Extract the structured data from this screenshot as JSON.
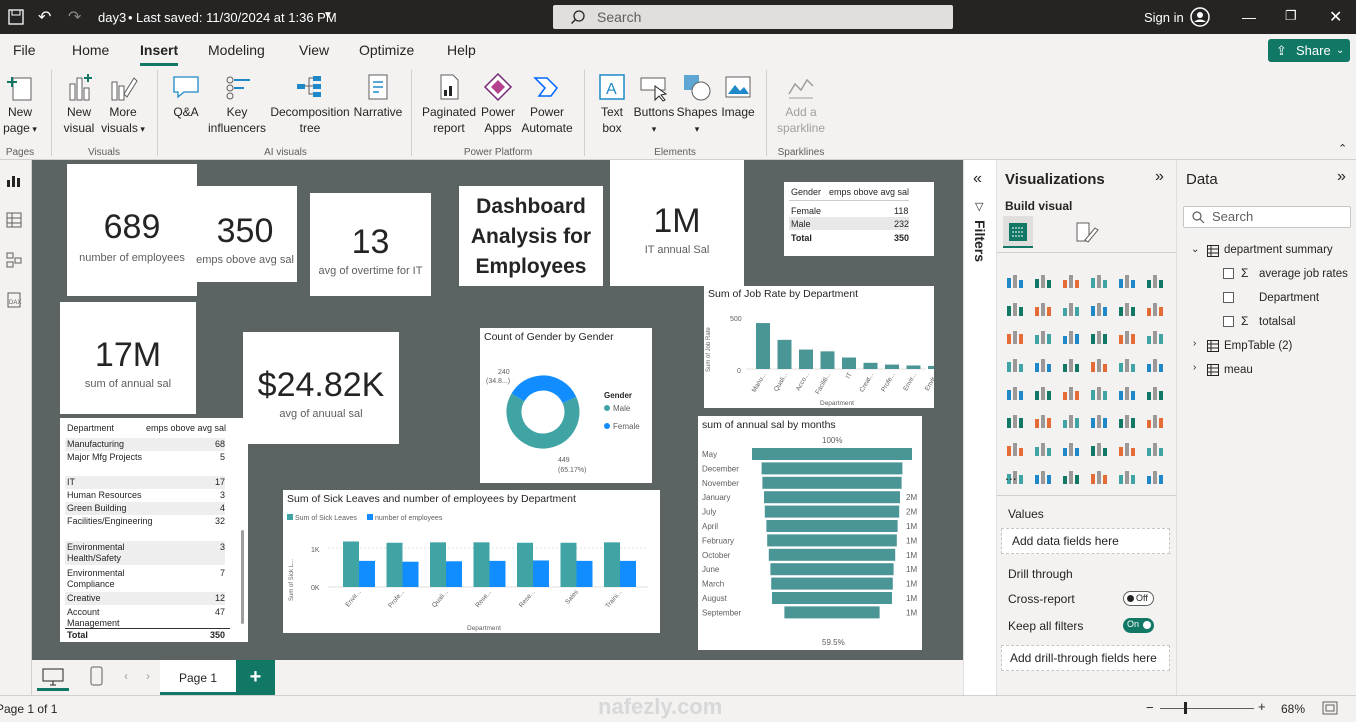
{
  "titlebar": {
    "file_title": "day3",
    "saved": "Last saved: 11/30/2024 at 1:36 PM",
    "search_placeholder": "Search",
    "signin": "Sign in"
  },
  "menu": {
    "file": "File",
    "home": "Home",
    "insert": "Insert",
    "modeling": "Modeling",
    "view": "View",
    "optimize": "Optimize",
    "help": "Help",
    "share": "Share"
  },
  "ribbon": {
    "new_page": [
      "New",
      "page"
    ],
    "new_visual": [
      "New",
      "visual"
    ],
    "more_visuals": [
      "More",
      "visuals"
    ],
    "qa": "Q&A",
    "key_influencers": [
      "Key",
      "influencers"
    ],
    "decomp": [
      "Decomposition",
      "tree"
    ],
    "narrative": "Narrative",
    "paginated": [
      "Paginated",
      "report"
    ],
    "power_apps": [
      "Power",
      "Apps"
    ],
    "power_automate": [
      "Power",
      "Automate"
    ],
    "text_box": [
      "Text",
      "box"
    ],
    "buttons": "Buttons",
    "shapes": "Shapes",
    "image": "Image",
    "sparkline": [
      "Add a",
      "sparkline"
    ],
    "groups": {
      "pages": "Pages",
      "visuals": "Visuals",
      "ai": "AI visuals",
      "platform": "Power Platform",
      "elements": "Elements",
      "sparklines": "Sparklines"
    }
  },
  "cards": {
    "employees": {
      "value": "689",
      "label": "number of employees"
    },
    "above": {
      "value": "350",
      "label": "emps obove avg sal"
    },
    "overtime": {
      "value": "13",
      "label": "avg of overtime for IT"
    },
    "title": "Dashboard Analysis for Employees",
    "it_sal": {
      "value": "1M",
      "label": "IT annual Sal"
    },
    "annual": {
      "value": "17M",
      "label": "sum of annual sal"
    },
    "avg_sal": {
      "value": "$24.82K",
      "label": "avg of anuual sal"
    }
  },
  "gender_table": {
    "headers": [
      "Gender",
      "emps obove avg sal"
    ],
    "rows": [
      [
        "Female",
        "118"
      ],
      [
        "Male",
        "232"
      ]
    ],
    "total": [
      "Total",
      "350"
    ]
  },
  "dept_table": {
    "headers": [
      "Department",
      "emps obove avg sal"
    ],
    "rows": [
      [
        "Manufacturing",
        "68"
      ],
      [
        "Major Mfg Projects",
        "5"
      ],
      [
        "IT",
        "17"
      ],
      [
        "Human Resources",
        "3"
      ],
      [
        "Green Building",
        "4"
      ],
      [
        "Facilities/Engineering",
        "32"
      ],
      [
        "Environmental Health/Safety",
        "3"
      ],
      [
        "Environmental Compliance",
        "7"
      ],
      [
        "Creative",
        "12"
      ],
      [
        "Account Management",
        "47"
      ]
    ],
    "total": [
      "Total",
      "350"
    ]
  },
  "job_rate": {
    "title": "Sum of Job Rate by Department",
    "ylabel": "Sum of Job Rate",
    "xlabel": "Department",
    "ticks": [
      "500",
      "0"
    ],
    "cats": [
      "Manu...",
      "Quali...",
      "Acco...",
      "Faciliti...",
      "IT",
      "Creat...",
      "Profe...",
      "Envir...",
      "Envir..."
    ]
  },
  "gender_donut": {
    "title": "Count of Gender by Gender",
    "legend_title": "Gender",
    "legend": [
      "Male",
      "Female"
    ],
    "label_a": "240",
    "label_a2": "(34.8...)",
    "label_b": "449",
    "label_b2": "(65.17%)"
  },
  "months": {
    "title": "sum of annual sal by months",
    "top": "100%",
    "bottom": "59.5%",
    "cats": [
      "May",
      "December",
      "November",
      "January",
      "July",
      "April",
      "February",
      "October",
      "June",
      "March",
      "August",
      "September"
    ],
    "labels": [
      "",
      "",
      "",
      "2M",
      "2M",
      "1M",
      "1M",
      "1M",
      "1M",
      "1M",
      "1M",
      "1M"
    ]
  },
  "sick": {
    "title": "Sum of Sick Leaves and number of employees by Department",
    "legend": [
      "Sum of Sick Leaves",
      "number of employees"
    ],
    "ylabel": "Sum of Sick L...",
    "xlabel": "Department",
    "ticks": [
      "1K",
      "0K"
    ],
    "cats": [
      "Envir...",
      "Profe...",
      "Quali...",
      "Rese...",
      "Rese...",
      "Sales",
      "Traini..."
    ]
  },
  "chart_data": [
    {
      "type": "bar",
      "title": "Sum of Job Rate by Department",
      "xlabel": "Department",
      "ylabel": "Sum of Job Rate",
      "categories": [
        "Manu...",
        "Quali...",
        "Acco...",
        "Faciliti...",
        "IT",
        "Creat...",
        "Profe...",
        "Envir...",
        "Envir..."
      ],
      "values": [
        520,
        330,
        220,
        200,
        130,
        70,
        50,
        40,
        35
      ],
      "ylim": [
        0,
        600
      ]
    },
    {
      "type": "pie",
      "title": "Count of Gender by Gender",
      "categories": [
        "Male",
        "Female"
      ],
      "values": [
        449,
        240
      ]
    },
    {
      "type": "bar",
      "title": "sum of annual sal by months",
      "categories": [
        "May",
        "December",
        "November",
        "January",
        "July",
        "April",
        "February",
        "October",
        "June",
        "March",
        "August",
        "September"
      ],
      "values": [
        100,
        88,
        87,
        85,
        84,
        82,
        81,
        79,
        77,
        76,
        75,
        59.5
      ]
    },
    {
      "type": "bar",
      "title": "Sum of Sick Leaves and number of employees by Department",
      "xlabel": "Department",
      "categories": [
        "Envir...",
        "Profe...",
        "Quali...",
        "Rese...",
        "Rese...",
        "Sales",
        "Traini..."
      ],
      "series": [
        {
          "name": "Sum of Sick Leaves",
          "values": [
            1080,
            1050,
            1060,
            1060,
            1050,
            1050,
            1060
          ]
        },
        {
          "name": "number of employees",
          "values": [
            620,
            600,
            610,
            620,
            630,
            620,
            620
          ]
        }
      ],
      "ylim": [
        0,
        1400
      ]
    }
  ],
  "filters_label": "Filters",
  "viz": {
    "title": "Visualizations",
    "build": "Build visual",
    "values": "Values",
    "add_fields": "Add data fields here",
    "drill": "Drill through",
    "cross": "Cross-report",
    "cross_state": "Off",
    "keep": "Keep all filters",
    "keep_state": "On",
    "add_drill": "Add drill-through fields here",
    "more": "..."
  },
  "data": {
    "title": "Data",
    "search": "Search",
    "tables": [
      {
        "name": "department summary",
        "fields": [
          "average job rates",
          "Department",
          "totalsal"
        ]
      },
      {
        "name": "EmpTable (2)"
      },
      {
        "name": "meau"
      }
    ]
  },
  "pages": {
    "page1": "Page 1"
  },
  "status": {
    "page": "Page 1 of 1",
    "zoom": "68%",
    "watermark": "nafezly.com"
  },
  "colors": {
    "accent": "#117865",
    "teal": "#41a4a4",
    "blue": "#118dff",
    "bar": "#4a9697"
  }
}
